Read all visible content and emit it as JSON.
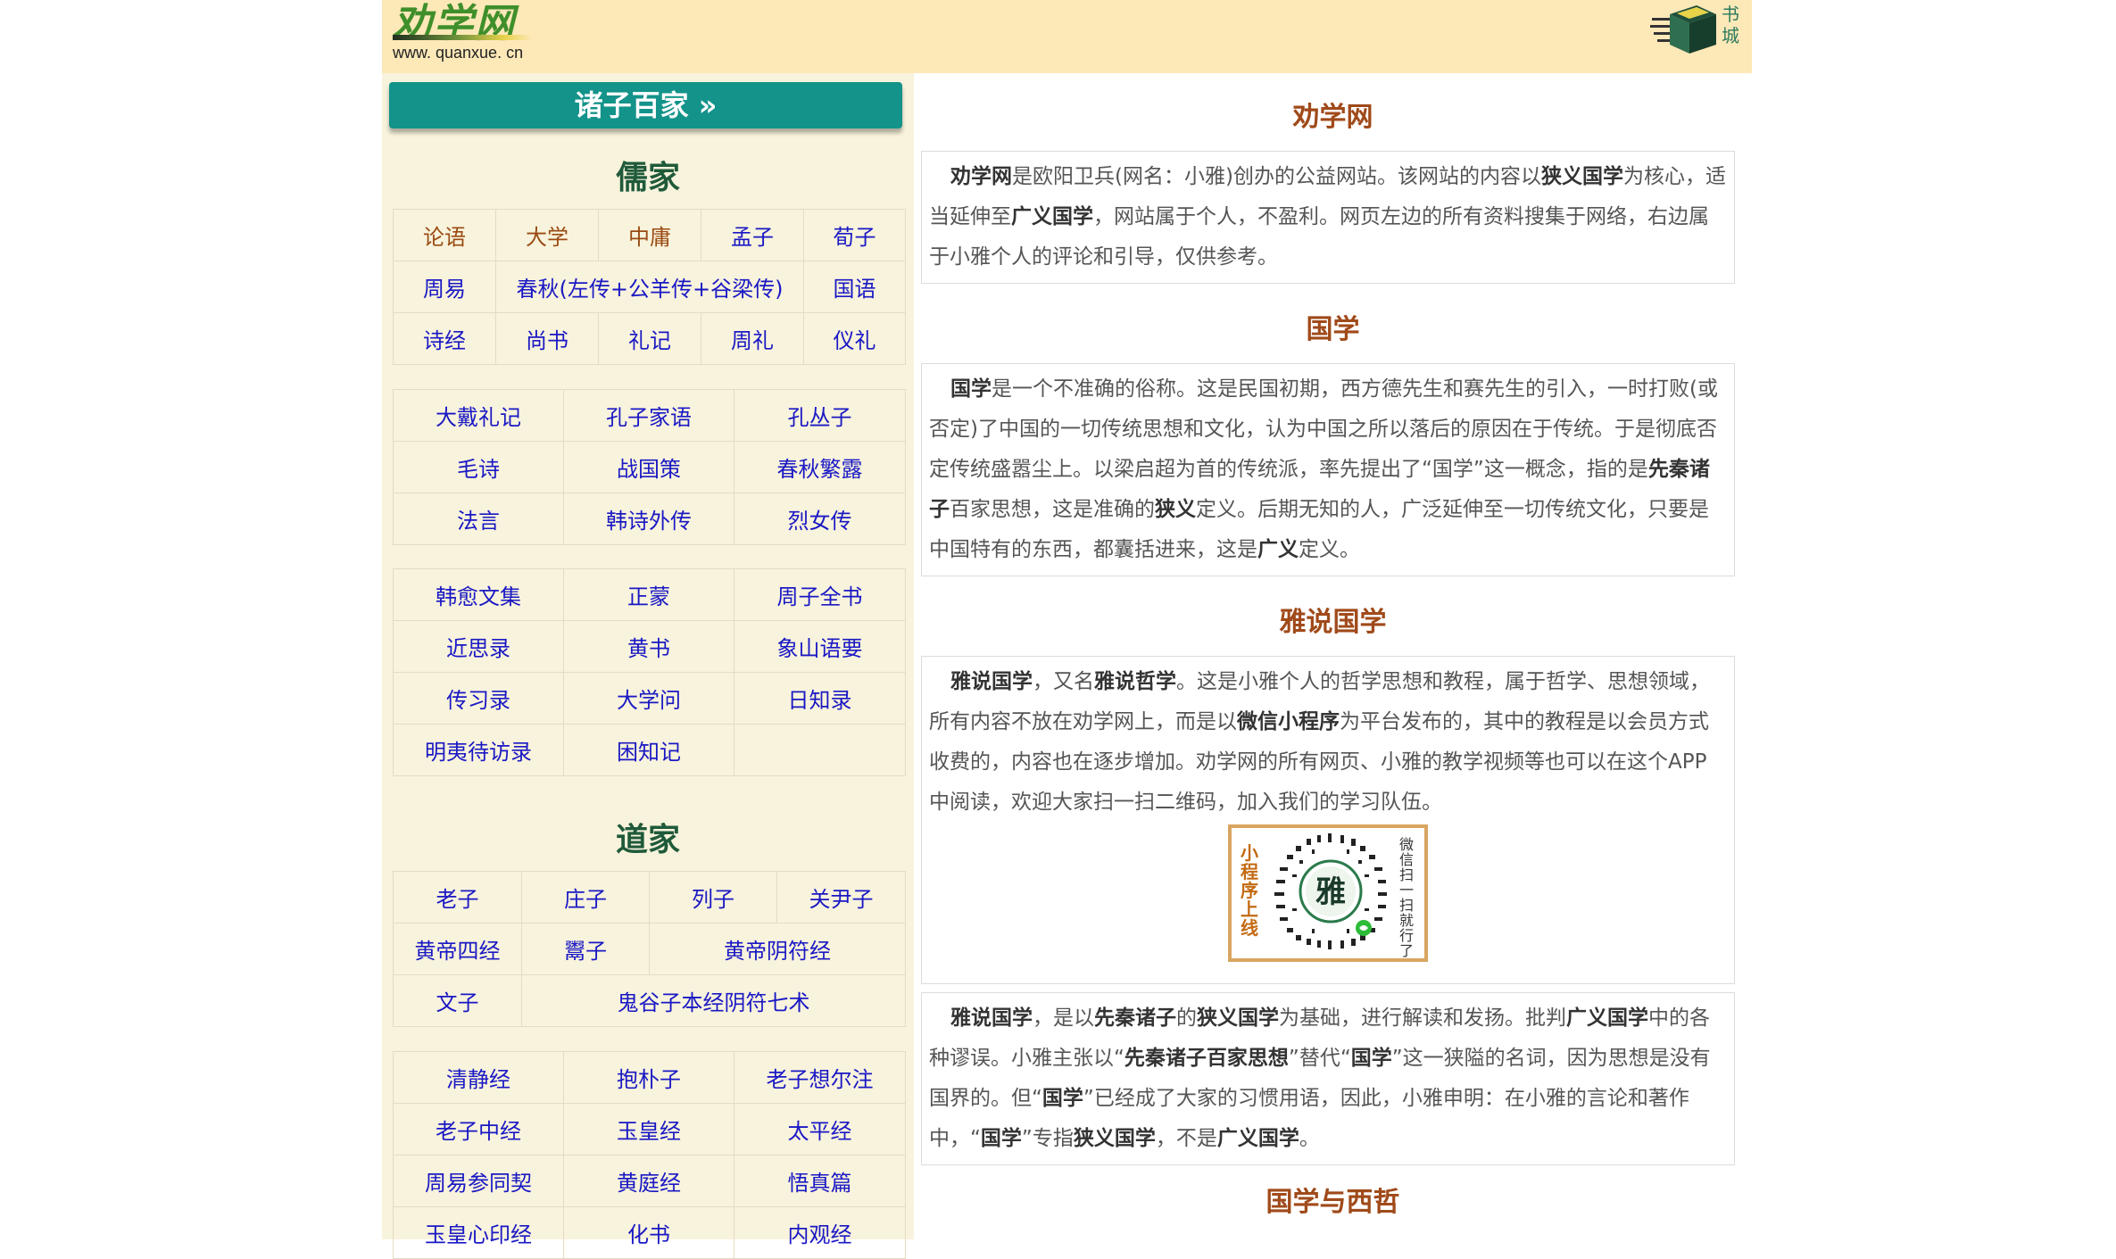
{
  "header": {
    "logo_text": "劝学网",
    "logo_url": "www. quanxue. cn",
    "bookstore_label": "书城"
  },
  "left": {
    "title": "诸子百家 »",
    "ru_title": "儒家",
    "ru_table1": [
      [
        "论语",
        "大学",
        "中庸",
        "孟子",
        "荀子"
      ],
      [
        "周易",
        "春秋(左传+公羊传+谷梁传)",
        "国语"
      ],
      [
        "诗经",
        "尚书",
        "礼记",
        "周礼",
        "仪礼"
      ]
    ],
    "ru_table2": [
      [
        "大戴礼记",
        "孔子家语",
        "孔丛子"
      ],
      [
        "毛诗",
        "战国策",
        "春秋繁露"
      ],
      [
        "法言",
        "韩诗外传",
        "烈女传"
      ]
    ],
    "ru_table3": [
      [
        "韩愈文集",
        "正蒙",
        "周子全书"
      ],
      [
        "近思录",
        "黄书",
        "象山语要"
      ],
      [
        "传习录",
        "大学问",
        "日知录"
      ],
      [
        "明夷待访录",
        "困知记",
        ""
      ]
    ],
    "dao_title": "道家",
    "dao_table1": [
      [
        "老子",
        "庄子",
        "列子",
        "关尹子"
      ],
      [
        "黄帝四经",
        "鬻子",
        "黄帝阴符经"
      ],
      [
        "文子",
        "鬼谷子本经阴符七术"
      ]
    ],
    "dao_table2": [
      [
        "清静经",
        "抱朴子",
        "老子想尔注"
      ],
      [
        "老子中经",
        "玉皇经",
        "太平经"
      ],
      [
        "周易参同契",
        "黄庭经",
        "悟真篇"
      ],
      [
        "玉皇心印经",
        "化书",
        "内观经"
      ]
    ]
  },
  "right": {
    "s1_title": "劝学网",
    "s2_title": "国学",
    "s3_title": "雅说国学",
    "s5_title": "国学与西哲",
    "qr_left": "小程序上线",
    "qr_right": "微信扫一扫就行了",
    "qr_center": "雅"
  }
}
